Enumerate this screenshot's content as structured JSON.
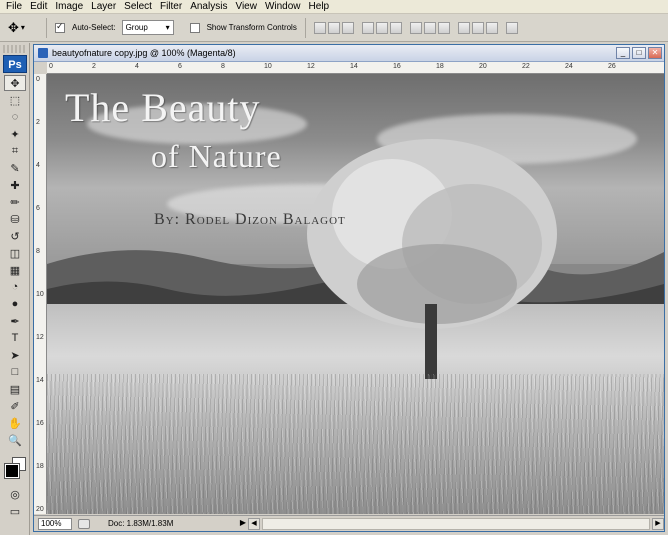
{
  "menu": [
    "File",
    "Edit",
    "Image",
    "Layer",
    "Select",
    "Filter",
    "Analysis",
    "View",
    "Window",
    "Help"
  ],
  "options": {
    "auto_select_label": "Auto-Select:",
    "auto_select_checked": true,
    "group_value": "Group",
    "show_transform_label": "Show Transform Controls",
    "show_transform_checked": false
  },
  "tools": {
    "logo": "Ps",
    "items": [
      "move-icon",
      "marquee-icon",
      "lasso-icon",
      "magic-wand-icon",
      "crop-icon",
      "eyedropper-icon",
      "healing-brush-icon",
      "brush-icon",
      "clone-stamp-icon",
      "history-brush-icon",
      "eraser-icon",
      "gradient-icon",
      "blur-icon",
      "dodge-icon",
      "pen-icon",
      "type-icon",
      "path-selection-icon",
      "shape-icon",
      "notes-icon",
      "eyedropper2-icon",
      "hand-icon",
      "zoom-icon"
    ],
    "glyphs": [
      "✥",
      "⬚",
      "◌",
      "✦",
      "⌗",
      "✎",
      "✚",
      "✏",
      "⛁",
      "↺",
      "◫",
      "▦",
      "◔",
      "●",
      "✒",
      "T",
      "➤",
      "□",
      "▤",
      "✐",
      "✋",
      "🔍"
    ]
  },
  "document": {
    "title": "beautyofnature copy.jpg @ 100% (Magenta/8)",
    "ruler_top": [
      "0",
      "2",
      "4",
      "6",
      "8",
      "10",
      "12",
      "14",
      "16",
      "18",
      "20",
      "22",
      "24",
      "26"
    ],
    "ruler_left": [
      "0",
      "2",
      "4",
      "6",
      "8",
      "10",
      "12",
      "14",
      "16",
      "18",
      "20"
    ],
    "image_text": {
      "line1": "The Beauty",
      "line2": "of Nature",
      "byline": "By: Rodel Dizon Balagot"
    }
  },
  "status": {
    "zoom": "100%",
    "doc_info": "Doc: 1.83M/1.83M"
  }
}
